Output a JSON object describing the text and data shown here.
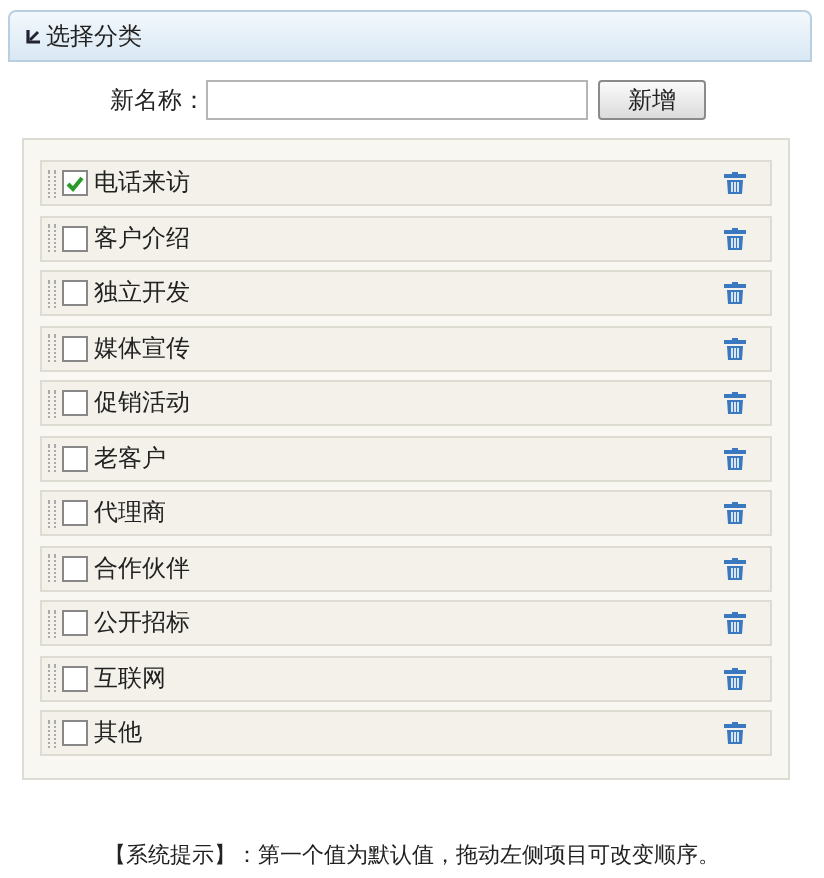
{
  "panel": {
    "title": "选择分类"
  },
  "form": {
    "label": "新名称：",
    "button": "新增"
  },
  "items": [
    {
      "label": "电话来访",
      "checked": true
    },
    {
      "label": "客户介绍",
      "checked": false
    },
    {
      "label": "独立开发",
      "checked": false
    },
    {
      "label": "媒体宣传",
      "checked": false
    },
    {
      "label": "促销活动",
      "checked": false
    },
    {
      "label": "老客户",
      "checked": false
    },
    {
      "label": "代理商",
      "checked": false
    },
    {
      "label": "合作伙伴",
      "checked": false
    },
    {
      "label": "公开招标",
      "checked": false
    },
    {
      "label": "互联网",
      "checked": false
    },
    {
      "label": "其他",
      "checked": false
    }
  ],
  "tip": "【系统提示】：第一个值为默认值，拖动左侧项目可改变顺序。"
}
